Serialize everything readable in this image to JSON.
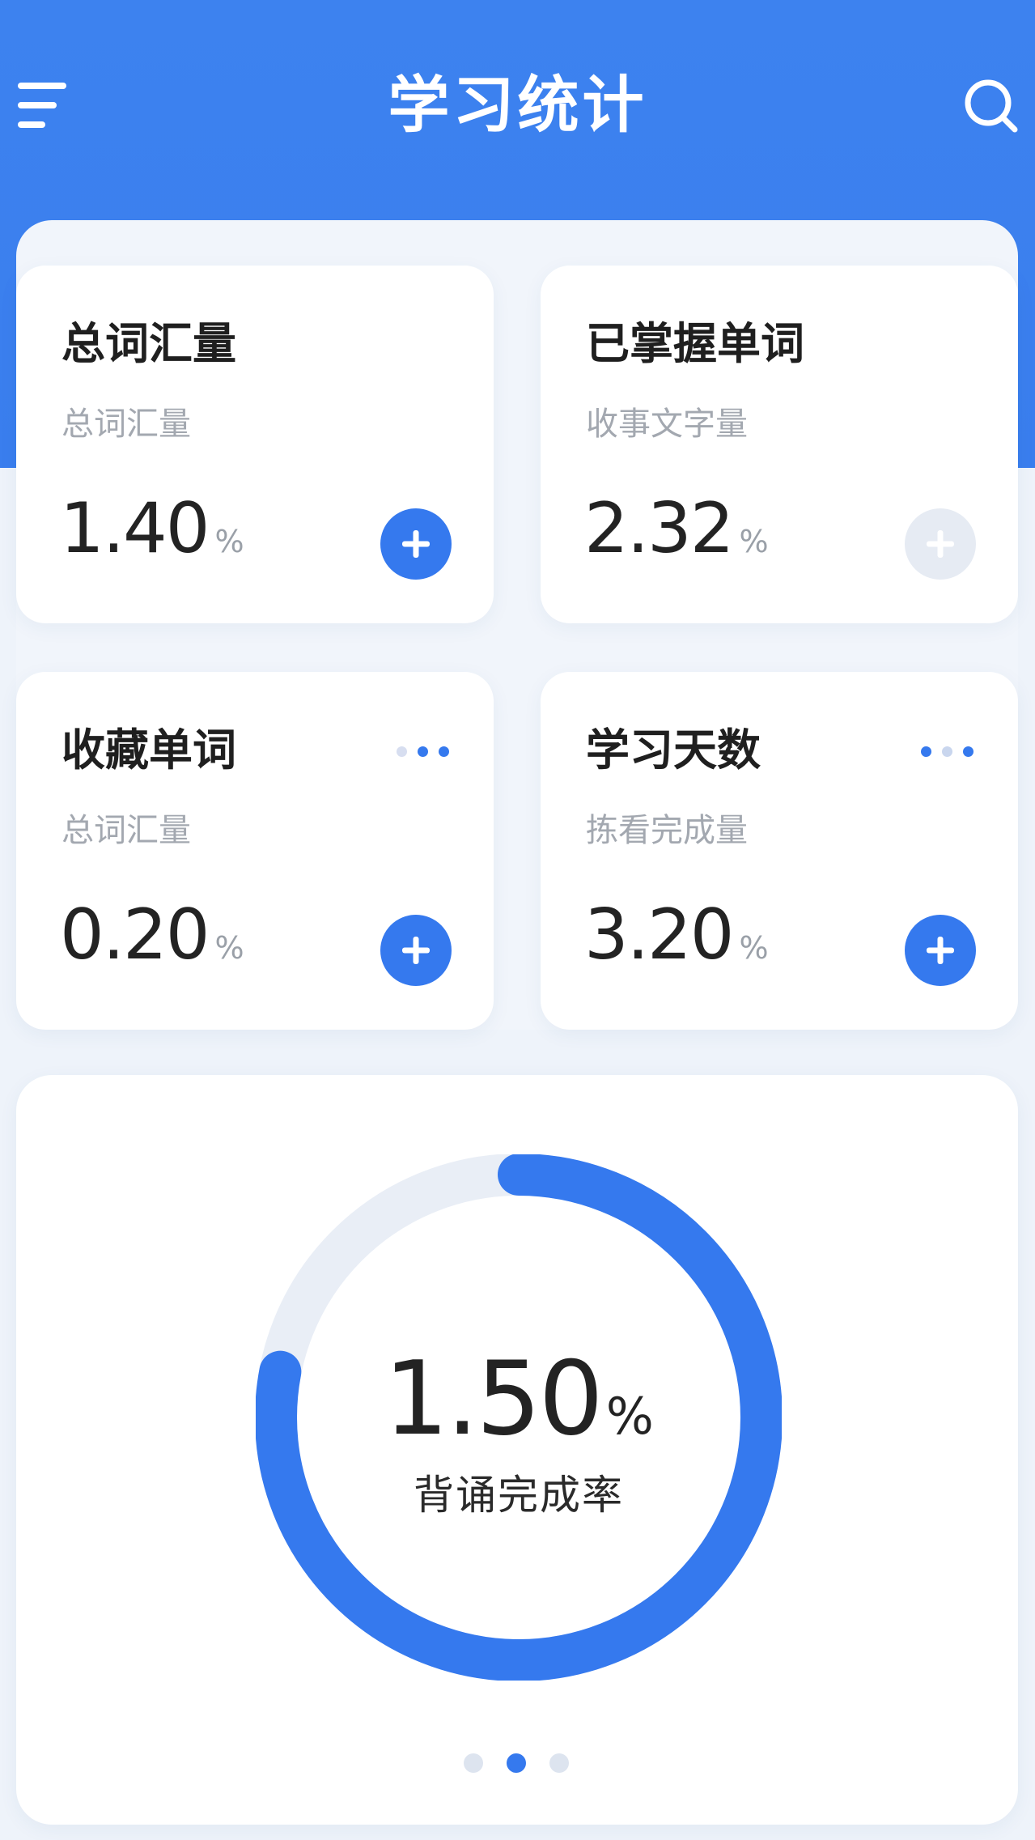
{
  "header": {
    "title": "学习统计",
    "menu_icon": "menu-icon",
    "search_icon": "search-icon"
  },
  "colors": {
    "primary": "#3a7eee",
    "accent_button": "#3579ee",
    "muted_button": "#e6ebf3",
    "page_background": "#eef3fa"
  },
  "cards": [
    {
      "title": "总词汇量",
      "subtitle": "总词汇量",
      "value": "1.40",
      "unit": "%",
      "action": "add-button"
    },
    {
      "title": "已掌握单词",
      "subtitle": "收事文字量",
      "value": "2.32",
      "unit": "%",
      "action": "add-button-disabled"
    },
    {
      "title": "收藏单词",
      "subtitle": "总词汇量",
      "value": "0.20",
      "unit": "%",
      "action": "add-button",
      "menu": "more-icon"
    },
    {
      "title": "学习天数",
      "subtitle": "拣看完成量",
      "value": "3.20",
      "unit": "%",
      "action": "add-button",
      "menu": "more-icon"
    }
  ],
  "summary": {
    "value": "1.50",
    "unit": "%",
    "label": "背诵完成率",
    "progress": 0.78
  },
  "pager": {
    "count": 3,
    "active_index": 1
  }
}
